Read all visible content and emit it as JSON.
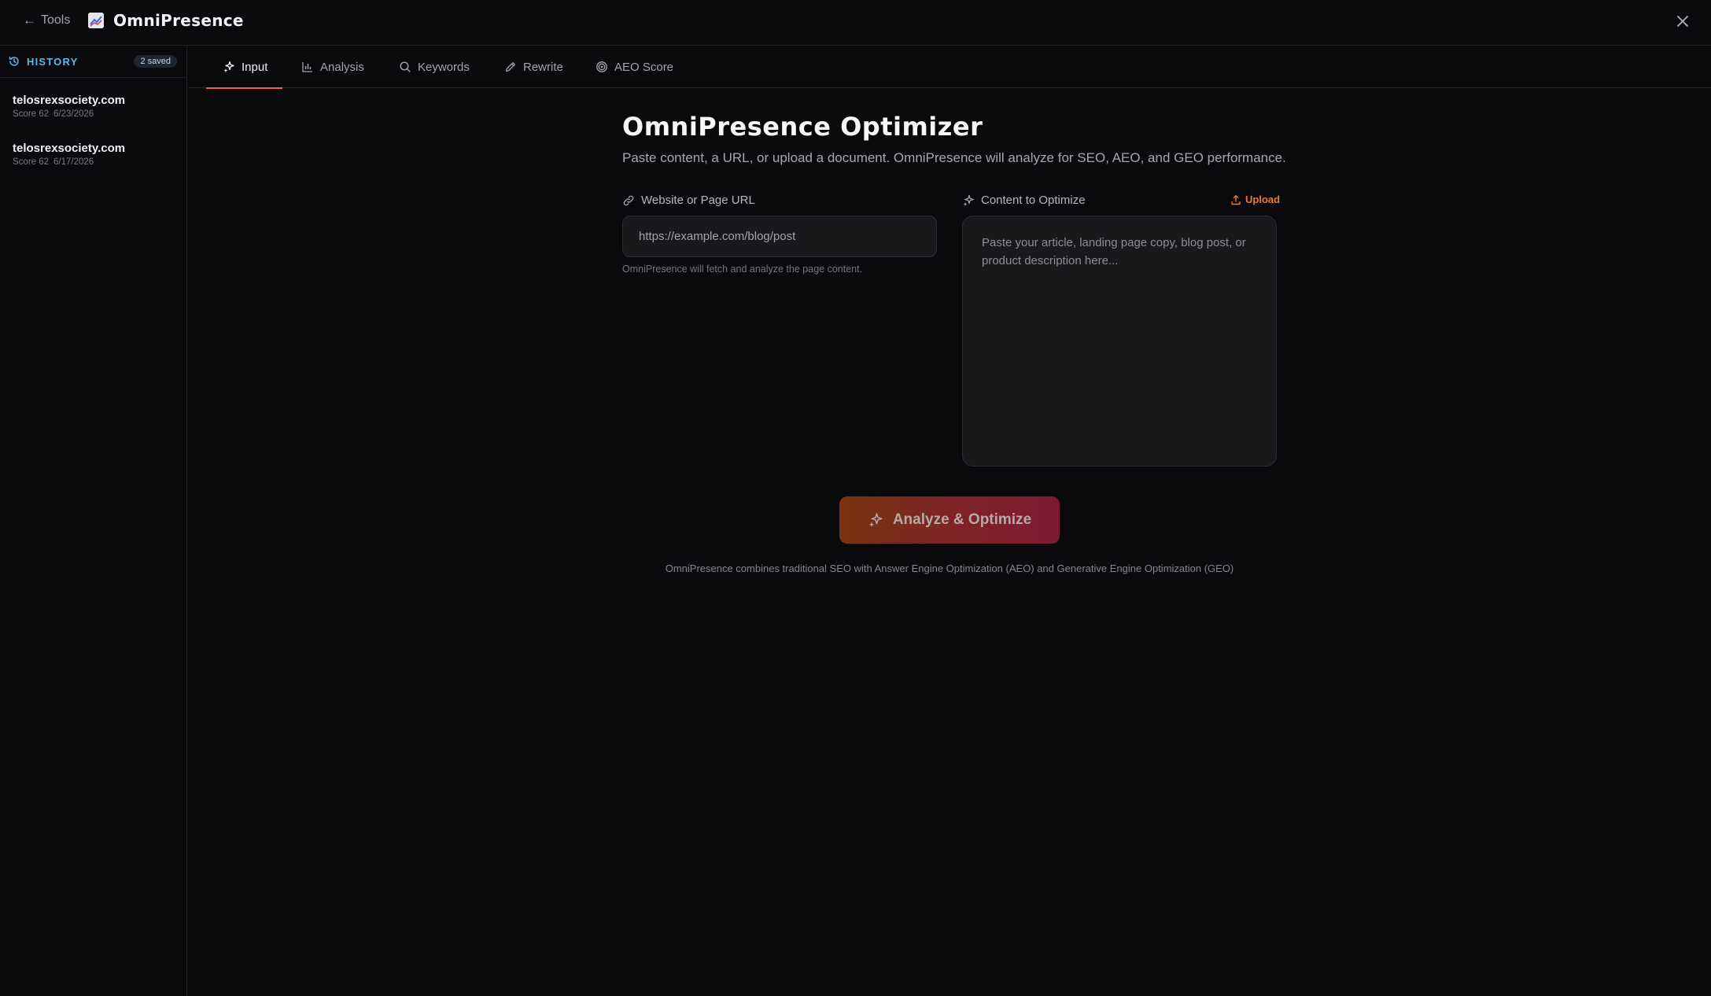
{
  "topbar": {
    "back_label": "Tools",
    "back_arrow": "←",
    "app_name": "OmniPresence"
  },
  "sidebar": {
    "title": "HISTORY",
    "saved_badge": "2 saved",
    "items": [
      {
        "domain": "telosrexsociety.com",
        "score": "Score 62",
        "date": "6/23/2026"
      },
      {
        "domain": "telosrexsociety.com",
        "score": "Score 62",
        "date": "6/17/2026"
      }
    ]
  },
  "tabs": [
    {
      "label": "Input",
      "icon": "sparkles-icon",
      "active": true
    },
    {
      "label": "Analysis",
      "icon": "bar-chart-icon",
      "active": false
    },
    {
      "label": "Keywords",
      "icon": "search-icon",
      "active": false
    },
    {
      "label": "Rewrite",
      "icon": "pencil-icon",
      "active": false
    },
    {
      "label": "AEO Score",
      "icon": "target-icon",
      "active": false
    }
  ],
  "main": {
    "title": "OmniPresence Optimizer",
    "subtitle": "Paste content, a URL, or upload a document. OmniPresence will analyze for SEO, AEO, and GEO performance.",
    "url_field": {
      "label": "Website or Page URL",
      "placeholder": "https://example.com/blog/post",
      "value": "",
      "hint": "OmniPresence will fetch and analyze the page content."
    },
    "content_field": {
      "label": "Content to Optimize",
      "upload_label": "Upload",
      "placeholder": "Paste your article, landing page copy, blog post, or product description here...",
      "value": ""
    },
    "analyze_button": "Analyze & Optimize",
    "footer_note": "OmniPresence combines traditional SEO with Answer Engine Optimization (AEO) and Generative Engine Optimization (GEO)"
  },
  "colors": {
    "accent": "#f06b2a",
    "history_title": "#5fb8e8",
    "background": "#0a0a0c",
    "button_gradient_start": "#7a3210",
    "button_gradient_end": "#7d1a32"
  }
}
